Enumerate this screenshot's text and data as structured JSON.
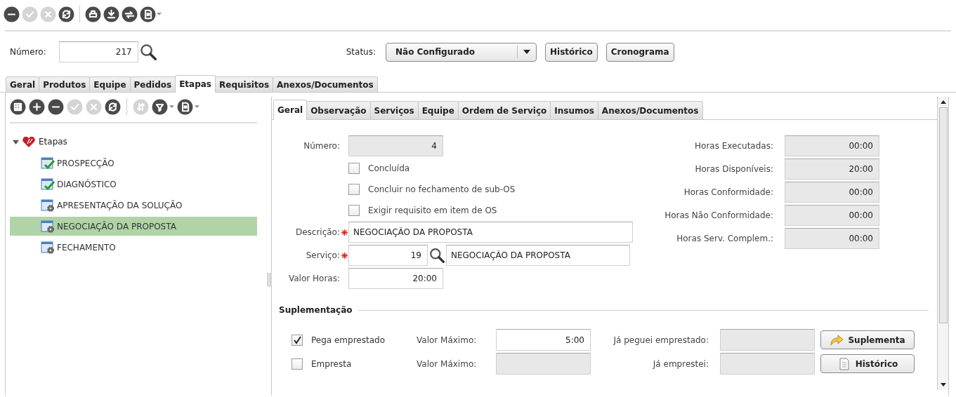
{
  "toolbar": [
    {
      "kind": "minus",
      "disabled": false
    },
    {
      "kind": "check",
      "disabled": true
    },
    {
      "kind": "close",
      "disabled": true
    },
    {
      "kind": "refresh",
      "disabled": false
    },
    {
      "kind": "separator"
    },
    {
      "kind": "print",
      "disabled": false
    },
    {
      "kind": "download",
      "disabled": false
    },
    {
      "kind": "swap",
      "disabled": false
    },
    {
      "kind": "export",
      "disabled": false
    },
    {
      "kind": "caret"
    }
  ],
  "header": {
    "number_label": "Número:",
    "number": "217",
    "status_label": "Status:",
    "status": "Não Configurado",
    "buttons": [
      "Histórico",
      "Cronograma"
    ]
  },
  "main_tabs": [
    {
      "label": "Geral",
      "selected": false
    },
    {
      "label": "Produtos",
      "selected": false
    },
    {
      "label": "Equipe",
      "selected": false
    },
    {
      "label": "Pedidos",
      "selected": false
    },
    {
      "label": "Etapas",
      "selected": true
    },
    {
      "label": "Requisitos",
      "selected": false
    },
    {
      "label": "Anexos/Documentos",
      "selected": false
    }
  ],
  "left_toolbar": [
    {
      "kind": "grid",
      "disabled": false
    },
    {
      "kind": "plus",
      "disabled": false
    },
    {
      "kind": "minus",
      "disabled": false
    },
    {
      "kind": "check",
      "disabled": true
    },
    {
      "kind": "close",
      "disabled": true
    },
    {
      "kind": "refresh",
      "disabled": false
    },
    {
      "kind": "separator"
    },
    {
      "kind": "sort",
      "disabled": true
    },
    {
      "kind": "filter",
      "disabled": false
    },
    {
      "kind": "caret"
    },
    {
      "kind": "export",
      "disabled": false
    },
    {
      "kind": "caret"
    }
  ],
  "tree": {
    "label": "Etapas",
    "expanded": true,
    "children": [
      {
        "label": "PROSPECÇÃO",
        "kind": "done",
        "selected": false
      },
      {
        "label": "DIAGNÓSTICO",
        "kind": "done",
        "selected": false
      },
      {
        "label": "APRESENTAÇÃO DA SOLUÇÃO",
        "kind": "pending",
        "selected": false
      },
      {
        "label": "NEGOCIAÇÃO DA PROPOSTA",
        "kind": "pending",
        "selected": true
      },
      {
        "label": "FECHAMENTO",
        "kind": "pending",
        "selected": false
      }
    ]
  },
  "sub_tabs": [
    {
      "label": "Geral",
      "selected": true
    },
    {
      "label": "Observação",
      "selected": false
    },
    {
      "label": "Serviços",
      "selected": false
    },
    {
      "label": "Equipe",
      "selected": false
    },
    {
      "label": "Ordem de Serviço",
      "selected": false
    },
    {
      "label": "Insumos",
      "selected": false
    },
    {
      "label": "Anexos/Documentos",
      "selected": false
    }
  ],
  "form": {
    "number_label": "Número:",
    "number": "4",
    "checks": [
      {
        "label": "Concluída",
        "checked": false
      },
      {
        "label": "Concluir no fechamento de sub-OS",
        "checked": false
      },
      {
        "label": "Exigir requisito em item de OS",
        "checked": false
      }
    ],
    "description_label": "Descrição:",
    "description_required": true,
    "description": "NEGOCIAÇÃO DA PROPOSTA",
    "service_label": "Serviço:",
    "service_required": true,
    "service_code": "19",
    "service_name": "NEGOCIAÇÃO DA PROPOSTA",
    "hours_label": "Valor Horas:",
    "hours": "20:00"
  },
  "hours": [
    {
      "label": "Horas Executadas:",
      "value": "00:00"
    },
    {
      "label": "Horas Disponíveis:",
      "value": "20:00"
    },
    {
      "label": "Horas Conformidade:",
      "value": "00:00"
    },
    {
      "label": "Horas Não Conformidade:",
      "value": "00:00"
    },
    {
      "label": "Horas Serv. Complem.:",
      "value": "00:00"
    }
  ],
  "supplement": {
    "title": "Suplementação",
    "rows": [
      {
        "label": "Pega emprestado",
        "checked": true,
        "max_label": "Valor Máximo:",
        "max": "5:00",
        "max_readonly": false,
        "other_label": "Já peguei emprestado:",
        "button": "Suplementa",
        "kind": "arrow"
      },
      {
        "label": "Empresta",
        "checked": false,
        "max_label": "Valor Máximo:",
        "max_readonly": true,
        "other_label": "Já emprestei:",
        "button": "Histórico",
        "kind": "page"
      }
    ]
  }
}
